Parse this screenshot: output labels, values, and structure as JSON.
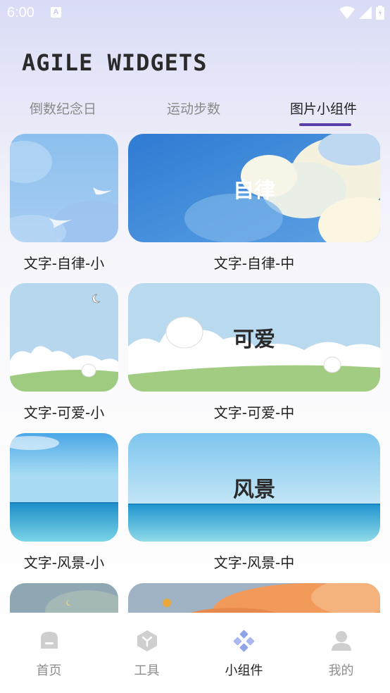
{
  "status_bar": {
    "time": "6:00"
  },
  "app": {
    "title": "AGILE WIDGETS"
  },
  "tabs": [
    {
      "label": "倒数纪念日"
    },
    {
      "label": "运动步数"
    },
    {
      "label": "图片小组件"
    }
  ],
  "widgets": [
    {
      "small_caption": "文字-自律-小",
      "medium_caption": "文字-自律-中",
      "overlay": "自律"
    },
    {
      "small_caption": "文字-可爱-小",
      "medium_caption": "文字-可爱-中",
      "overlay": "可爱"
    },
    {
      "small_caption": "文字-风景-小",
      "medium_caption": "文字-风景-中",
      "overlay": "风景"
    }
  ],
  "bottom_nav": [
    {
      "label": "首页",
      "icon": "home-icon"
    },
    {
      "label": "工具",
      "icon": "tools-icon"
    },
    {
      "label": "小组件",
      "icon": "widgets-icon"
    },
    {
      "label": "我的",
      "icon": "profile-icon"
    }
  ],
  "colors": {
    "accent": "#5a3fa6",
    "nav_active_icon": "#8fa3e6",
    "nav_inactive_icon": "#cfcfcf"
  }
}
